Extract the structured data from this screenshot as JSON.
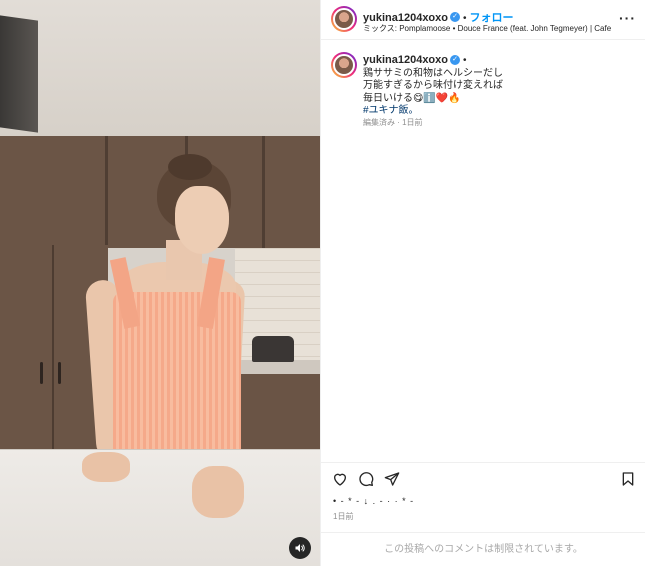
{
  "header": {
    "username": "yukina1204xoxo",
    "separator": "•",
    "follow_label": "フォロー",
    "audio": "ミックス: Pomplamoose • Douce France (feat. John Tegmeyer) | Cafe ...",
    "more_label": "···"
  },
  "caption": {
    "username": "yukina1204xoxo",
    "separator": "•",
    "lines": [
      "鶏ササミの和物はヘルシーだし",
      "万能すぎるから味付け変えれば",
      "毎日いける😋ℹ️❤️🔥"
    ],
    "hashtag": "#ユキナ飯。",
    "meta": "編集済み · 1日前"
  },
  "actions": {
    "like_icon": "heart-icon",
    "comment_icon": "comment-icon",
    "share_icon": "share-icon",
    "save_icon": "bookmark-icon"
  },
  "likes_text": "• - * - ↓ . - ·   ·  * -",
  "date": "1日前",
  "comments_disabled": "この投稿へのコメントは制限されています。",
  "colors": {
    "link_blue": "#0095f6",
    "hashtag": "#00376b",
    "muted": "#8e8e8e",
    "border": "#efefef"
  }
}
